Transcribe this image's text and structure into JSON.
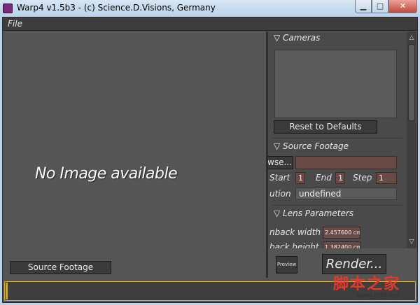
{
  "window": {
    "title": "Warp4  v1.5b3 - (c) Science.D.Visions, Germany"
  },
  "menu": {
    "file": "File"
  },
  "viewer": {
    "placeholder": "No Image available",
    "source_footage_button": "Source Footage"
  },
  "cameras": {
    "header": "▽  Cameras",
    "reset_button": "Reset to Defaults"
  },
  "source_footage": {
    "header": "▽  Source Footage",
    "browse_button": "wse...",
    "start_label": "Start",
    "start_value": "1",
    "end_label": "End",
    "end_value": "1",
    "step_label": "Step",
    "step_value": "1",
    "resolution_label": "ution",
    "resolution_value": "undefined"
  },
  "lens": {
    "header": "▽  Lens Parameters",
    "width_label": "nback width",
    "width_value": "2.457600 cm",
    "height_label": "back height",
    "height_value": "1.382400 cm"
  },
  "actions": {
    "preview": "Preview",
    "render": "Render..."
  },
  "progress": {
    "fraction": 0.005
  },
  "watermark": {
    "text": "脚本之家",
    "url": "www.jb51.net"
  },
  "icons": {
    "minimize": "minimize-icon",
    "maximize": "maximize-icon",
    "close": "close-icon",
    "scroll_up": "scroll-up-icon",
    "scroll_down": "scroll-down-icon",
    "app": "warp-app-icon"
  }
}
